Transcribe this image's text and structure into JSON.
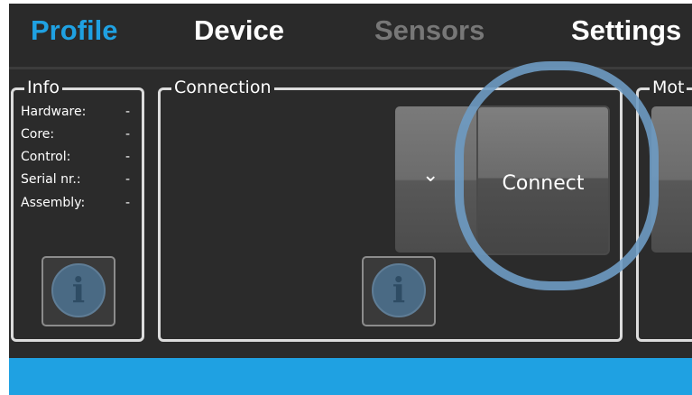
{
  "nav": {
    "tabs": [
      {
        "label": "Profile",
        "color": "#1fa1e2"
      },
      {
        "label": "Device",
        "color": "#ffffff"
      },
      {
        "label": "Sensors",
        "color": "#777777"
      },
      {
        "label": "Settings",
        "color": "#ffffff"
      }
    ]
  },
  "info": {
    "title": "Info",
    "rows": [
      {
        "label": "Hardware:",
        "value": "-"
      },
      {
        "label": "Core:",
        "value": "-"
      },
      {
        "label": "Control:",
        "value": "-"
      },
      {
        "label": "Serial nr.:",
        "value": "-"
      },
      {
        "label": "Assembly:",
        "value": "-"
      }
    ],
    "button_icon": "i"
  },
  "connection": {
    "title": "Connection",
    "dropdown_icon": "⌄",
    "connect_label": "Connect",
    "button_icon": "i"
  },
  "motor": {
    "title": "Mot"
  },
  "colors": {
    "accent": "#1fa1e2",
    "highlight": "#6e9bc3"
  }
}
